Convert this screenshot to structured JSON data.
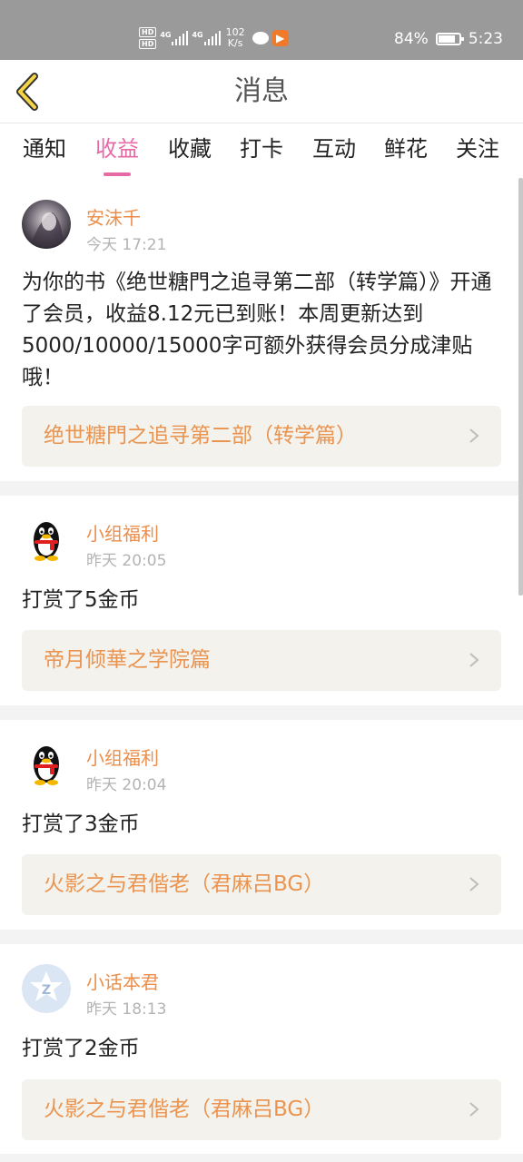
{
  "status_bar": {
    "hd1": "HD",
    "hd2": "HD",
    "net1": "4G",
    "net2": "4G",
    "speed_value": "102",
    "speed_unit": "K/s",
    "app_icon": "▶",
    "battery_text": "84%",
    "battery_level": 0.84,
    "time": "5:23"
  },
  "header": {
    "title": "消息"
  },
  "tabs": [
    {
      "label": "通知",
      "active": false
    },
    {
      "label": "收益",
      "active": true
    },
    {
      "label": "收藏",
      "active": false
    },
    {
      "label": "打卡",
      "active": false
    },
    {
      "label": "互动",
      "active": false
    },
    {
      "label": "鲜花",
      "active": false
    },
    {
      "label": "关注",
      "active": false
    }
  ],
  "messages": [
    {
      "sender": "安沫千",
      "time": "今天 17:21",
      "avatar": "photo-avatar",
      "body": "为你的书《绝世糖門之追寻第二部（转学篇）》开通了会员，收益8.12元已到账！本周更新达到5000/10000/15000字可额外获得会员分成津贴哦！",
      "book": "绝世糖門之追寻第二部（转学篇）"
    },
    {
      "sender": "小组福利",
      "time": "昨天 20:05",
      "avatar": "penguin-avatar",
      "body": "打赏了5金币",
      "book": "帝月倾華之学院篇"
    },
    {
      "sender": "小组福利",
      "time": "昨天 20:04",
      "avatar": "penguin-avatar",
      "body": "打赏了3金币",
      "book": "火影之与君偕老（君麻吕BG）"
    },
    {
      "sender": "小话本君",
      "time": "昨天 18:13",
      "avatar": "z-logo-avatar",
      "body": "打赏了2金币",
      "book": "火影之与君偕老（君麻吕BG）"
    }
  ],
  "colors": {
    "accent_pink": "#e56aa6",
    "sender_orange": "#eb8e4c",
    "book_orange": "#ea9451",
    "status_bar_gray": "#9a9a9a"
  }
}
